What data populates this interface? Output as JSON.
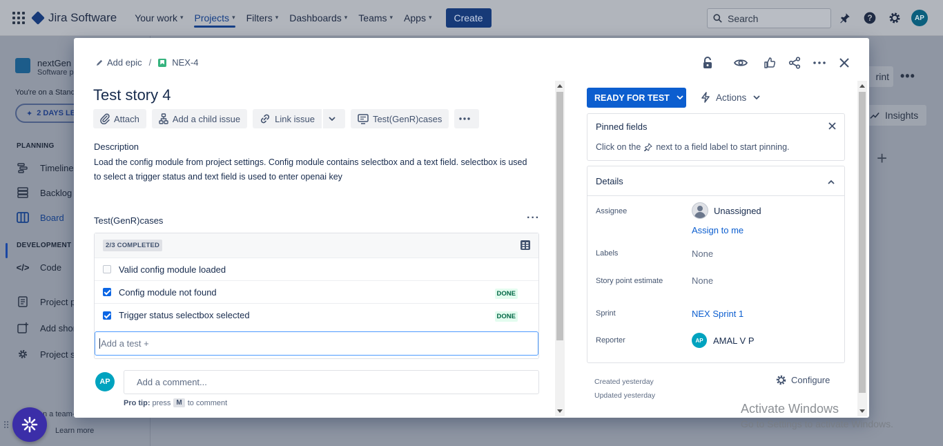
{
  "topnav": {
    "product": "Jira Software",
    "items": [
      {
        "label": "Your work",
        "chevron": "▾"
      },
      {
        "label": "Projects",
        "chevron": "▾"
      },
      {
        "label": "Filters",
        "chevron": "▾"
      },
      {
        "label": "Dashboards",
        "chevron": "▾"
      },
      {
        "label": "Teams",
        "chevron": "▾"
      },
      {
        "label": "Apps",
        "chevron": "▾"
      }
    ],
    "create_label": "Create",
    "search_placeholder": "Search",
    "avatar_initials": "AP",
    "active_color": "#163f86"
  },
  "sidebar": {
    "project_name": "nextGen",
    "project_sub": "Software p",
    "std_note": "You're on a Stand",
    "days_pill": "2 DAYS LEF",
    "planning_label": "PLANNING",
    "development_label": "DEVELOPMENT",
    "items": {
      "timeline": "Timeline",
      "backlog": "Backlog",
      "board": "Board",
      "code": "Code",
      "project_pages": "Project pa",
      "add_shortcut": "Add shor",
      "project_settings": "Project se"
    },
    "team_line": "n a team-",
    "learn_more": "Learn more"
  },
  "board_bg": {
    "sprint_btn": "rint",
    "insights": "Insights"
  },
  "modal": {
    "breadcrumb": {
      "add_epic": "Add epic",
      "separator": "/",
      "issue_key": "NEX-4"
    },
    "title": "Test story 4",
    "actions": {
      "attach": "Attach",
      "add_child": "Add a child issue",
      "link_issue": "Link issue",
      "test_cases": "Test(GenR)cases"
    },
    "description": {
      "label": "Description",
      "text": "Load the config module from project settings. Config module contains selectbox and a text field. selectbox is used to select a trigger status and text field is used to enter openai key"
    },
    "test_cases": {
      "label": "Test(GenR)cases",
      "progress": "2/3 COMPLETED",
      "items": [
        {
          "text": "Valid config module loaded",
          "checked": false,
          "status": ""
        },
        {
          "text": "Config module not found",
          "checked": true,
          "status": "DONE"
        },
        {
          "text": "Trigger status selectbox selected",
          "checked": true,
          "status": "DONE"
        }
      ],
      "add_placeholder": "Add a test +"
    },
    "comment": {
      "avatar_initials": "AP",
      "placeholder": "Add a comment...",
      "pro_tip_label": "Pro tip:",
      "pro_tip_press": "press",
      "pro_tip_key": "M",
      "pro_tip_suffix": "to comment"
    },
    "status": {
      "label": "READY FOR TEST",
      "color": "#0c5ecf"
    },
    "actions_label": "Actions",
    "pinned": {
      "title": "Pinned fields",
      "text_before": "Click on the",
      "text_after": "next to a field label to start pinning."
    },
    "details": {
      "title": "Details",
      "assignee_label": "Assignee",
      "assignee_value": "Unassigned",
      "assign_to_me": "Assign to me",
      "labels_label": "Labels",
      "labels_value": "None",
      "spe_label": "Story point estimate",
      "spe_value": "None",
      "sprint_label": "Sprint",
      "sprint_value": "NEX Sprint 1",
      "reporter_label": "Reporter",
      "reporter_initials": "AP",
      "reporter_value": "AMAL V P"
    },
    "created": "Created yesterday",
    "updated": "Updated yesterday",
    "configure": "Configure"
  },
  "watermark": {
    "line1": "Activate Windows",
    "line2": "Go to Settings to activate Windows."
  }
}
